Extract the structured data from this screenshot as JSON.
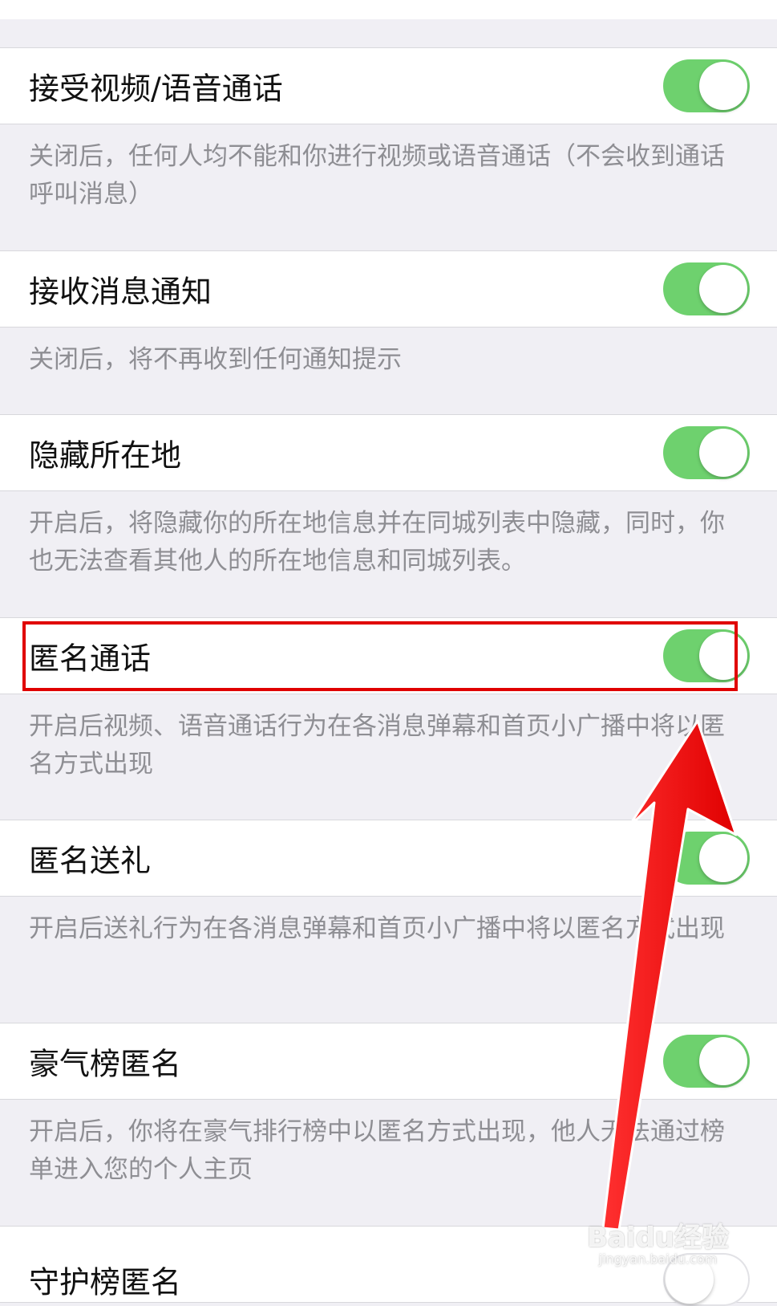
{
  "settings": [
    {
      "label": "接受视频/语音通话",
      "enabled": true,
      "description": "关闭后，任何人均不能和你进行视频或语音通话（不会收到通话呼叫消息）"
    },
    {
      "label": "接收消息通知",
      "enabled": true,
      "description": "关闭后，将不再收到任何通知提示"
    },
    {
      "label": "隐藏所在地",
      "enabled": true,
      "description": "开启后，将隐藏你的所在地信息并在同城列表中隐藏，同时，你也无法查看其他人的所在地信息和同城列表。"
    },
    {
      "label": "匿名通话",
      "enabled": true,
      "description": "开启后视频、语音通话行为在各消息弹幕和首页小广播中将以匿名方式出现"
    },
    {
      "label": "匿名送礼",
      "enabled": true,
      "description": "开启后送礼行为在各消息弹幕和首页小广播中将以匿名方式出现"
    },
    {
      "label": "豪气榜匿名",
      "enabled": true,
      "description": "开启后，你将在豪气排行榜中以匿名方式出现，他人无法通过榜单进入您的个人主页"
    },
    {
      "label": "守护榜匿名",
      "enabled": false
    }
  ],
  "colors": {
    "toggle_on": "#6ed16e",
    "highlight": "#e00000",
    "arrow": "#ff1a1a"
  },
  "watermark": {
    "brand": "Baidu经验",
    "site": "jingyan.baidu.com"
  }
}
